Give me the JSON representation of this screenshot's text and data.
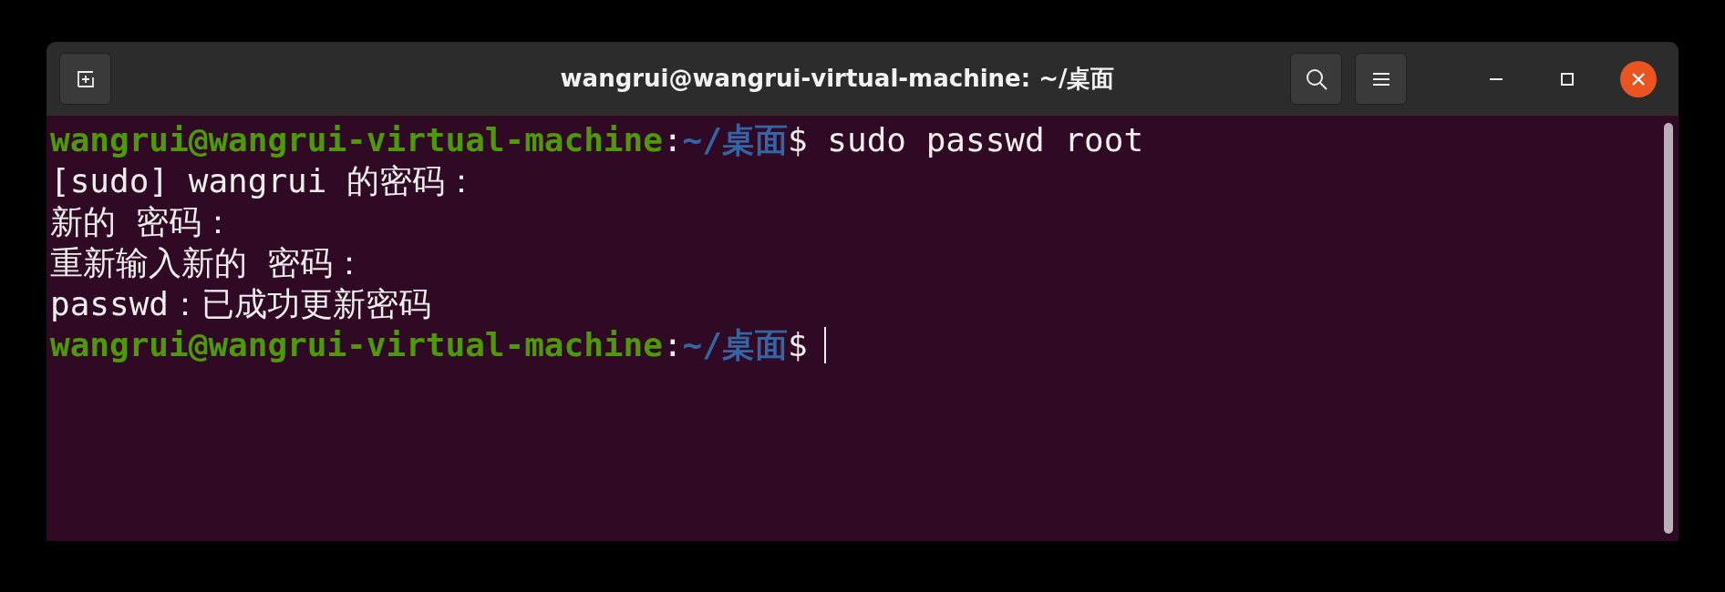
{
  "window": {
    "title": "wangrui@wangrui-virtual-machine: ~/桌面"
  },
  "terminal": {
    "lines": [
      {
        "kind": "prompt",
        "user_host": "wangrui@wangrui-virtual-machine",
        "separator": ":",
        "path": "~/桌面",
        "symbol": "$",
        "command": "sudo passwd root",
        "cursor": false
      },
      {
        "kind": "output",
        "text": "[sudo] wangrui 的密码："
      },
      {
        "kind": "output",
        "text": "新的 密码："
      },
      {
        "kind": "output",
        "text": "重新输入新的 密码："
      },
      {
        "kind": "output",
        "text": "passwd：已成功更新密码"
      },
      {
        "kind": "prompt",
        "user_host": "wangrui@wangrui-virtual-machine",
        "separator": ":",
        "path": "~/桌面",
        "symbol": "$",
        "cursor": true
      }
    ]
  }
}
